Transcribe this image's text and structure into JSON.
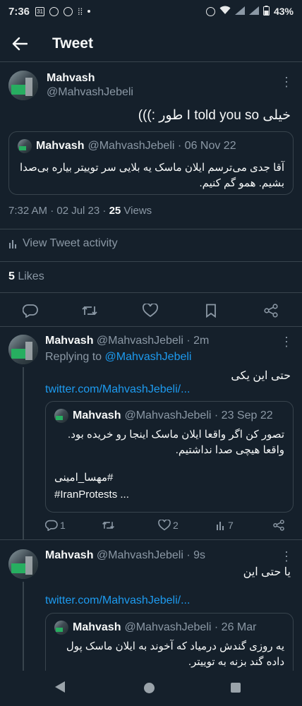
{
  "status_bar": {
    "time": "7:36",
    "battery": "43%"
  },
  "header": {
    "title": "Tweet"
  },
  "main_tweet": {
    "name": "Mahvash",
    "handle": "@MahvashJebeli",
    "text": "خیلی I told you so طور :)))",
    "quoted": {
      "name": "Mahvash",
      "handle": "@MahvashJebeli",
      "date": "· 06 Nov 22",
      "text": "آقا جدی می‌ترسم ایلان ماسک یه بلایی سر توییتر بیاره بی‌صدا بشیم. همو گم کنیم."
    },
    "timestamp": "7:32 AM · 02 Jul 23 · ",
    "views_count": "25",
    "views_label": " Views",
    "activity_label": "View Tweet activity",
    "likes_count": "5",
    "likes_label": " Likes"
  },
  "replies": [
    {
      "name": "Mahvash",
      "handle": "@MahvashJebeli · 2m",
      "replying_prefix": "Replying to ",
      "replying_handle": "@MahvashJebeli",
      "text": "حتی این یکی",
      "link": "twitter.com/MahvashJebeli/...",
      "quoted": {
        "name": "Mahvash",
        "handle": "@MahvashJebeli",
        "date": "· 23 Sep 22",
        "text": "تصور کن اگر واقعا ایلان ماسک اینجا رو خریده بود. واقعا هیچی صدا نداشتیم.",
        "hashtag1": "#مهسا_امینی",
        "hashtag2": "#IranProtests ..."
      },
      "replies_count": "1",
      "likes_count": "2",
      "views_count": "7"
    },
    {
      "name": "Mahvash",
      "handle": "@MahvashJebeli · 9s",
      "text": "یا حتی این",
      "link": "twitter.com/MahvashJebeli/...",
      "quoted": {
        "name": "Mahvash",
        "handle": "@MahvashJebeli",
        "date": "· 26 Mar",
        "text": "یه روزی گندش درمیاد که آخوند به ایلان ماسک پول داده گند بزنه به توییتر."
      }
    }
  ]
}
